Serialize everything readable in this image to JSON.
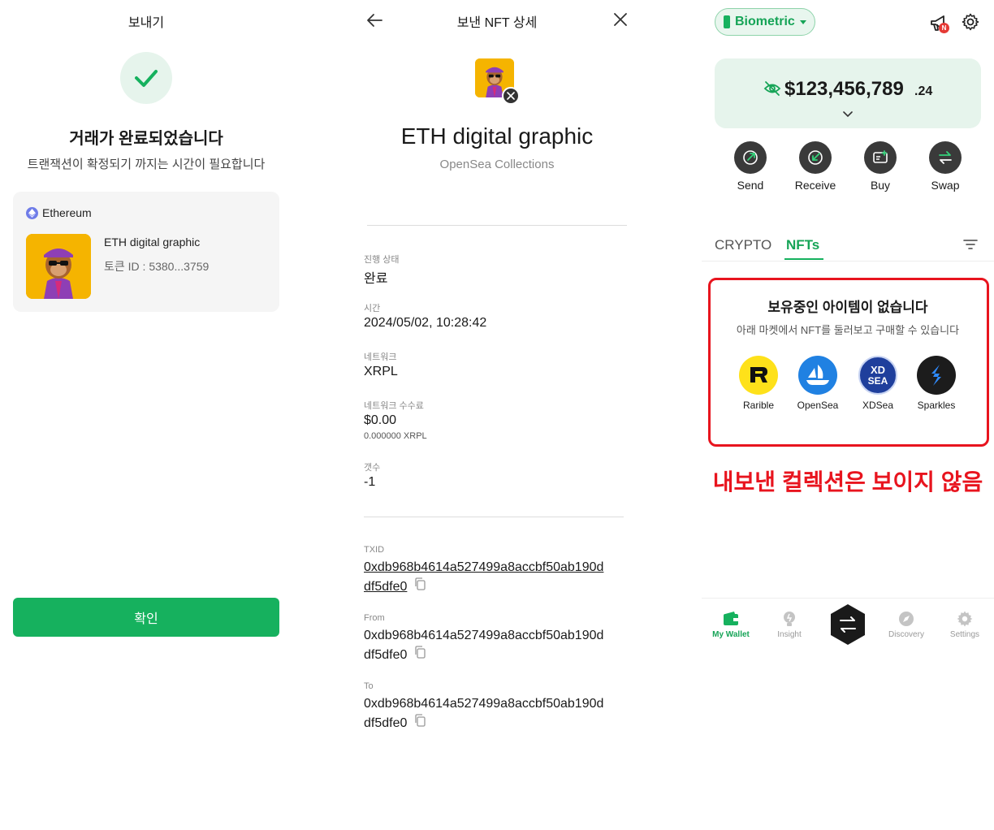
{
  "send_complete": {
    "title": "보내기",
    "heading": "거래가 완료되었습니다",
    "subtitle": "트랜잭션이 확정되기 까지는 시간이 필요합니다",
    "card": {
      "network": "Ethereum",
      "nft_name": "ETH digital graphic",
      "token_id": "토큰 ID : 5380...3759"
    },
    "confirm_label": "확인"
  },
  "nft_detail": {
    "title": "보낸 NFT 상세",
    "nft_name": "ETH digital graphic",
    "collection": "OpenSea Collections",
    "fields": {
      "status_label": "진행 상태",
      "status_value": "완료",
      "time_label": "시간",
      "time_value": "2024/05/02, 10:28:42",
      "network_label": "네트워크",
      "network_value": "XRPL",
      "fee_label": "네트워크 수수료",
      "fee_value": "$0.00",
      "fee_sub": "0.000000 XRPL",
      "count_label": "갯수",
      "count_value": "-1"
    },
    "txid_label": "TXID",
    "txid_line1": "0xdb968b4614a527499a8accbf50ab190d",
    "txid_line2": "df5dfe0",
    "from_label": "From",
    "from_line1": "0xdb968b4614a527499a8accbf50ab190d",
    "from_line2": "df5dfe0",
    "to_label": "To",
    "to_line1": "0xdb968b4614a527499a8accbf50ab190d",
    "to_line2": "df5dfe0"
  },
  "wallet": {
    "security_mode": "Biometric",
    "notification_badge": "N",
    "balance_main": "$123,456,789",
    "balance_decimal": ".24",
    "actions": [
      "Send",
      "Receive",
      "Buy",
      "Swap"
    ],
    "tabs": [
      "CRYPTO",
      "NFTs"
    ],
    "empty_title": "보유중인 아이템이 없습니다",
    "empty_subtitle": "아래 마켓에서 NFT를 둘러보고 구매할 수 있습니다",
    "markets": [
      "Rarible",
      "OpenSea",
      "XDSea",
      "Sparkles"
    ],
    "annotation": "내보낸 컬렉션은 보이지 않음",
    "nav": [
      "My Wallet",
      "Insight",
      "Discovery",
      "Settings"
    ],
    "accent_color": "#16b15e",
    "annotation_color": "#e8141e"
  }
}
